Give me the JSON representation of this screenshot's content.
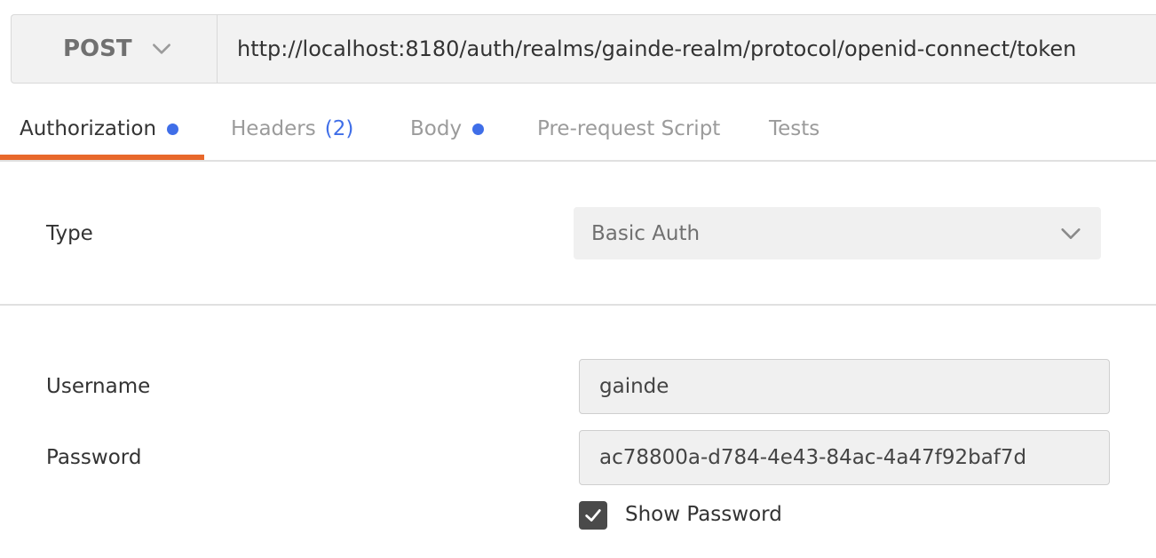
{
  "request": {
    "method": "POST",
    "url": "http://localhost:8180/auth/realms/gainde-realm/protocol/openid-connect/token"
  },
  "tabs": [
    {
      "label": "Authorization",
      "active": true,
      "dot": true
    },
    {
      "label": "Headers",
      "count": "(2)"
    },
    {
      "label": "Body",
      "dot": true
    },
    {
      "label": "Pre-request Script"
    },
    {
      "label": "Tests"
    }
  ],
  "auth": {
    "type_label": "Type",
    "type_value": "Basic Auth",
    "username_label": "Username",
    "username_value": "gainde",
    "password_label": "Password",
    "password_value": "ac78800a-d784-4e43-84ac-4a47f92baf7d",
    "show_password_label": "Show Password",
    "show_password_checked": true
  },
  "colors": {
    "accent_underline": "#e8682b",
    "dot_blue": "#3f6ee8"
  },
  "icons": {
    "method_dropdown": "chevron-down-icon",
    "type_dropdown": "chevron-down-icon",
    "checkbox": "checkmark-icon"
  }
}
